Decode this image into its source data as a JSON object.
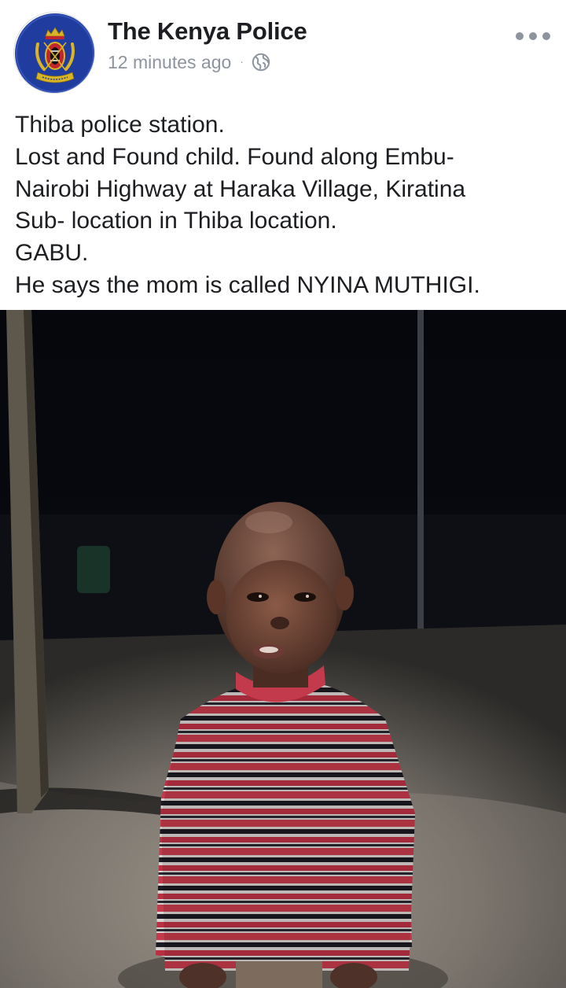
{
  "post": {
    "page_name": "The Kenya Police",
    "timestamp": "12 minutes ago",
    "separator": "·",
    "audience_icon": "globe-icon",
    "more_icon": "more-horizontal-icon",
    "text_lines": [
      "Thiba police station.",
      "Lost and Found child. Found along Embu-",
      "Nairobi Highway at  Haraka Village, Kiratina",
      "Sub- location in Thiba location.",
      "GABU.",
      "He says the mom is called NYINA MUTHIGI."
    ]
  },
  "colors": {
    "name_text": "#1c1e21",
    "meta_text": "#8d949e",
    "logo_blue": "#1f3c9e",
    "logo_gold": "#d9b526",
    "logo_red": "#c0262d"
  }
}
